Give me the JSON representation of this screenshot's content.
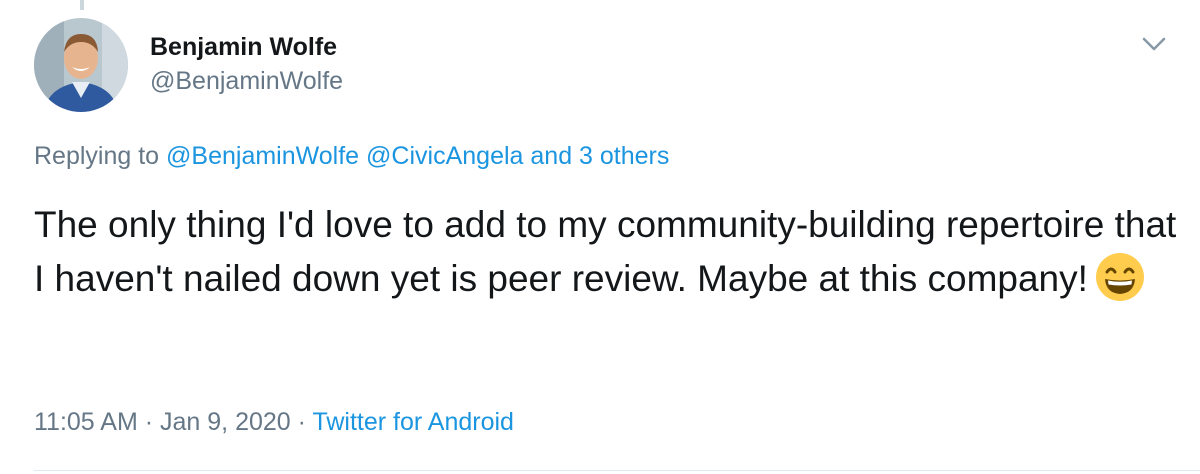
{
  "tweet": {
    "author": {
      "display_name": "Benjamin Wolfe",
      "handle": "@BenjaminWolfe",
      "avatar_icon": "profile-photo"
    },
    "reply_context": {
      "prefix": "Replying to",
      "mentions": [
        "@BenjaminWolfe",
        "@CivicAngela",
        "and 3 others"
      ]
    },
    "text": "The only thing I'd love to add to my community-building repertoire that I haven't nailed down yet is peer review. Maybe at this company!",
    "emoji": "grinning-face-with-smiling-eyes",
    "time": "11:05 AM",
    "separator": "·",
    "date": "Jan 9, 2020",
    "source": "Twitter for Android"
  },
  "colors": {
    "link": "#1b95e0",
    "secondary_text": "#657786",
    "primary_text": "#14171a",
    "border": "#e1e8ed"
  },
  "icons": {
    "caret": "chevron-down-icon"
  }
}
